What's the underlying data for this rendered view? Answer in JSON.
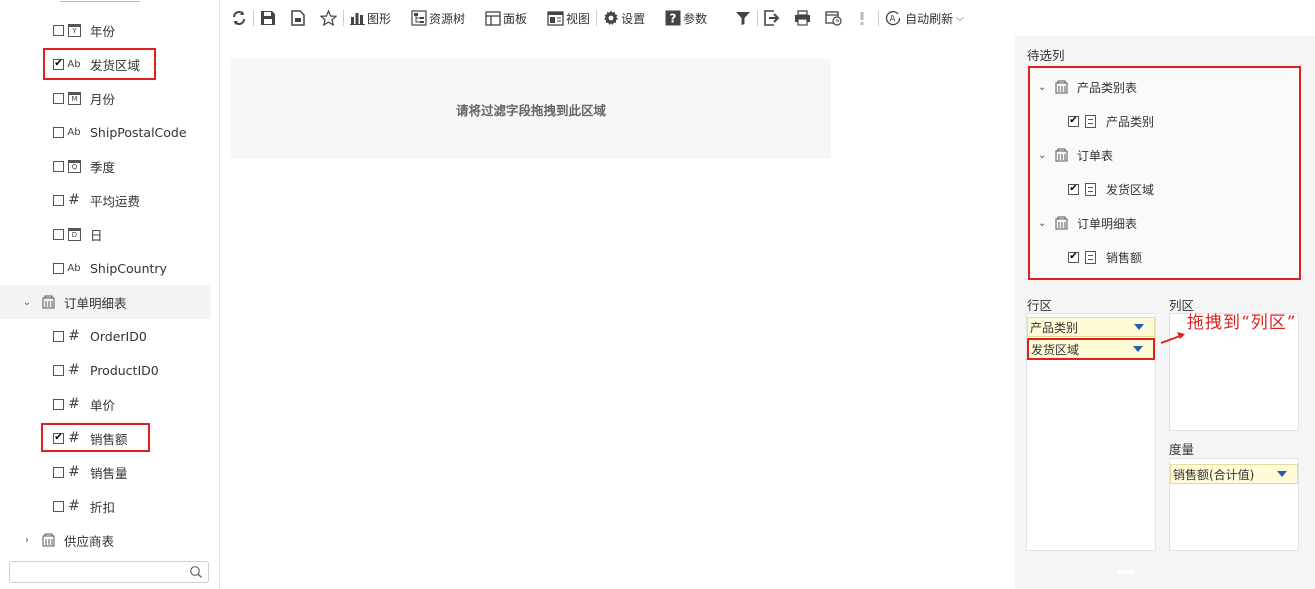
{
  "left_panel": {
    "fields_top": [
      {
        "label": "年份",
        "type": "calendar",
        "type_glyph": "Y",
        "checked": false
      },
      {
        "label": "发货区域",
        "type": "string",
        "type_glyph": "Ab",
        "checked": true
      },
      {
        "label": "月份",
        "type": "calendar",
        "type_glyph": "M",
        "checked": false
      },
      {
        "label": "ShipPostalCode",
        "type": "string",
        "type_glyph": "Ab",
        "checked": false
      },
      {
        "label": "季度",
        "type": "calendar",
        "type_glyph": "Q",
        "checked": false
      },
      {
        "label": "平均运费",
        "type": "number",
        "type_glyph": "#",
        "checked": false
      },
      {
        "label": "日",
        "type": "calendar",
        "type_glyph": "D",
        "checked": false
      },
      {
        "label": "ShipCountry",
        "type": "string",
        "type_glyph": "Ab",
        "checked": false
      }
    ],
    "table_order_detail": {
      "label": "订单明细表",
      "expanded": true
    },
    "fields_detail": [
      {
        "label": "OrderID0",
        "type": "number",
        "type_glyph": "#",
        "checked": false
      },
      {
        "label": "ProductID0",
        "type": "number",
        "type_glyph": "#",
        "checked": false
      },
      {
        "label": "单价",
        "type": "number",
        "type_glyph": "#",
        "checked": false
      },
      {
        "label": "销售额",
        "type": "number",
        "type_glyph": "#",
        "checked": true
      },
      {
        "label": "销售量",
        "type": "number",
        "type_glyph": "#",
        "checked": false
      },
      {
        "label": "折扣",
        "type": "number",
        "type_glyph": "#",
        "checked": false
      }
    ],
    "table_supplier": {
      "label": "供应商表",
      "expanded": false
    },
    "search": {
      "placeholder": ""
    }
  },
  "toolbar": {
    "graph_label": "图形",
    "resource_tree_label": "资源树",
    "panel_label": "面板",
    "view_label": "视图",
    "settings_label": "设置",
    "params_label": "参数",
    "auto_refresh_label": "自动刷新"
  },
  "main": {
    "filter_drop_hint": "请将过滤字段拖拽到此区域"
  },
  "right_panel": {
    "candidates_title": "待选列",
    "candidates": [
      {
        "table": "产品类别表",
        "fields": [
          {
            "label": "产品类别",
            "checked": true
          }
        ]
      },
      {
        "table": "订单表",
        "fields": [
          {
            "label": "发货区域",
            "checked": true
          }
        ]
      },
      {
        "table": "订单明细表",
        "fields": [
          {
            "label": "销售额",
            "checked": true
          }
        ]
      }
    ],
    "row_zone_title": "行区",
    "row_zone_items": [
      "产品类别",
      "发货区域"
    ],
    "column_zone_title": "列区",
    "measure_zone_title": "度量",
    "measure_items": [
      "销售额(合计值)"
    ],
    "annotation": "拖拽到“列区”"
  },
  "colors": {
    "highlight_red": "#e02020",
    "pill_bg": "#fffbd6",
    "dropdown_triangle": "#1f5fb4"
  }
}
